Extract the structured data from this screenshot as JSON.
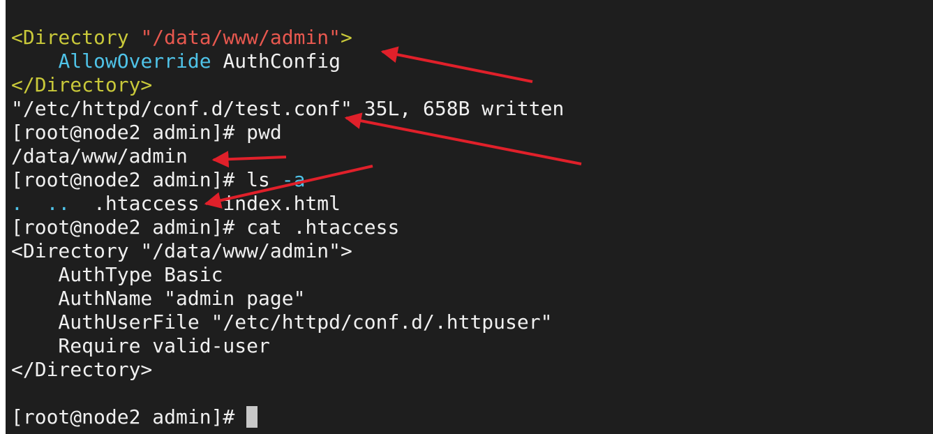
{
  "terminal": {
    "lines": [
      {
        "id": "l1",
        "segs": [
          [
            "tag",
            "<Directory "
          ],
          [
            "str",
            "\"/data/www/admin\""
          ],
          [
            "tag",
            ">"
          ]
        ]
      },
      {
        "id": "l2",
        "segs": [
          [
            "txt",
            "    "
          ],
          [
            "kw",
            "AllowOverride"
          ],
          [
            "txt",
            " AuthConfig"
          ]
        ]
      },
      {
        "id": "l3",
        "segs": [
          [
            "tag",
            "</Directory>"
          ]
        ]
      },
      {
        "id": "l4",
        "segs": [
          [
            "txt",
            "\"/etc/httpd/conf.d/test.conf\" 35L, 658B written"
          ]
        ]
      },
      {
        "id": "l5",
        "segs": [
          [
            "txt",
            "[root@node2 admin]# pwd"
          ]
        ]
      },
      {
        "id": "l6",
        "segs": [
          [
            "txt",
            "/data/www/admin"
          ]
        ]
      },
      {
        "id": "l7",
        "segs": [
          [
            "txt",
            "[root@node2 admin]# ls "
          ],
          [
            "kw",
            "-a"
          ]
        ]
      },
      {
        "id": "l8",
        "segs": [
          [
            "kw",
            ".  .."
          ],
          [
            "txt",
            "  .htaccess  index.html"
          ]
        ]
      },
      {
        "id": "l9",
        "segs": [
          [
            "txt",
            "[root@node2 admin]# cat .htaccess"
          ]
        ]
      },
      {
        "id": "l10",
        "segs": [
          [
            "txt",
            "<Directory \"/data/www/admin\">"
          ]
        ]
      },
      {
        "id": "l11",
        "segs": [
          [
            "txt",
            "    AuthType Basic"
          ]
        ]
      },
      {
        "id": "l12",
        "segs": [
          [
            "txt",
            "    AuthName \"admin page\""
          ]
        ]
      },
      {
        "id": "l13",
        "segs": [
          [
            "txt",
            "    AuthUserFile \"/etc/httpd/conf.d/.httpuser\""
          ]
        ]
      },
      {
        "id": "l14",
        "segs": [
          [
            "txt",
            "    Require valid-user"
          ]
        ]
      },
      {
        "id": "l15",
        "segs": [
          [
            "txt",
            "</Directory>"
          ]
        ]
      },
      {
        "id": "l16",
        "segs": [
          [
            "txt",
            ""
          ]
        ]
      },
      {
        "id": "l17",
        "segs": [
          [
            "txt",
            "[root@node2 admin]# "
          ]
        ],
        "cursor": true
      }
    ]
  },
  "colors": {
    "background": "#1e1e1e",
    "text": "#f0f0f0",
    "tag": "#c9c93a",
    "string": "#e8584f",
    "keyword": "#4fc3e8",
    "arrow": "#e0202a"
  }
}
